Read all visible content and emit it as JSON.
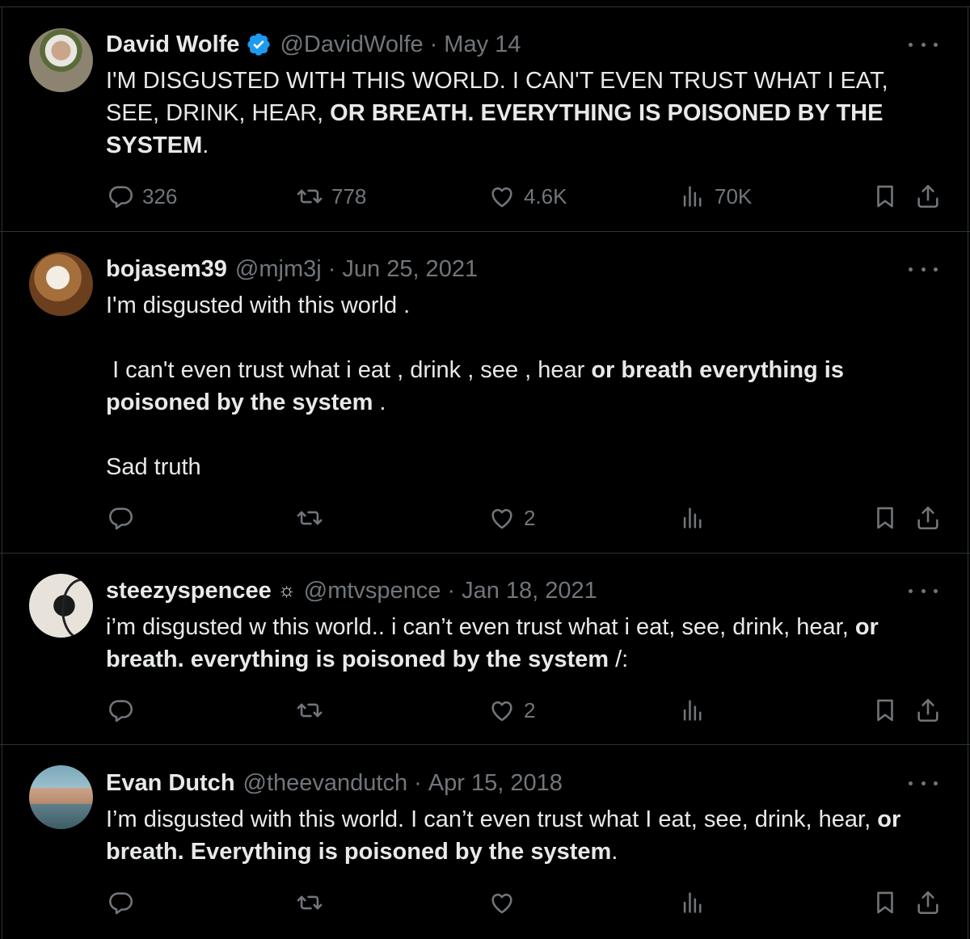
{
  "tweets": [
    {
      "name": "David Wolfe",
      "verified": true,
      "handle": "@DavidWolfe",
      "date": "May 14",
      "text_parts": [
        {
          "t": "I'M DISGUSTED WITH THIS WORLD. I CAN'T EVEN TRUST WHAT I EAT, SEE, DRINK, HEAR, ",
          "b": false
        },
        {
          "t": "OR BREATH. EVERYTHING IS POISONED BY THE SYSTEM",
          "b": true
        },
        {
          "t": ".",
          "b": false
        }
      ],
      "replies": "326",
      "retweets": "778",
      "likes": "4.6K",
      "views": "70K"
    },
    {
      "name": "bojasem39",
      "handle": "@mjm3j",
      "date": "Jun 25, 2021",
      "text_parts": [
        {
          "t": "I'm disgusted with this world .\n\n I can't even trust what i eat , drink , see , hear ",
          "b": false
        },
        {
          "t": "or breath everything is poisoned by the system",
          "b": true
        },
        {
          "t": " .\n\nSad truth",
          "b": false
        }
      ],
      "replies": "",
      "retweets": "",
      "likes": "2",
      "views": ""
    },
    {
      "name": "steezyspencee",
      "name_suffix": "☼",
      "handle": "@mtvspence",
      "date": "Jan 18, 2021",
      "text_parts": [
        {
          "t": "i’m disgusted w this world.. i can’t even trust what i eat, see, drink, hear, ",
          "b": false
        },
        {
          "t": "or breath. everything is poisoned by the system",
          "b": true
        },
        {
          "t": " /:",
          "b": false
        }
      ],
      "replies": "",
      "retweets": "",
      "likes": "2",
      "views": ""
    },
    {
      "name": "Evan Dutch",
      "handle": "@theevandutch",
      "date": "Apr 15, 2018",
      "text_parts": [
        {
          "t": "I’m disgusted with this world. I can’t even trust what I eat, see, drink, hear, ",
          "b": false
        },
        {
          "t": "or breath. Everything is poisoned by the system",
          "b": true
        },
        {
          "t": ".",
          "b": false
        }
      ],
      "replies": "",
      "retweets": "",
      "likes": "",
      "views": ""
    }
  ],
  "icons": {
    "verified": "verified-badge-icon",
    "reply": "reply-icon",
    "retweet": "retweet-icon",
    "like": "heart-icon",
    "views": "views-icon",
    "bookmark": "bookmark-icon",
    "share": "share-icon",
    "more": "more-icon"
  },
  "colors": {
    "background": "#000000",
    "text": "#e7e9ea",
    "muted": "#71767b",
    "verified": "#1d9bf0",
    "divider": "#2f3336"
  }
}
